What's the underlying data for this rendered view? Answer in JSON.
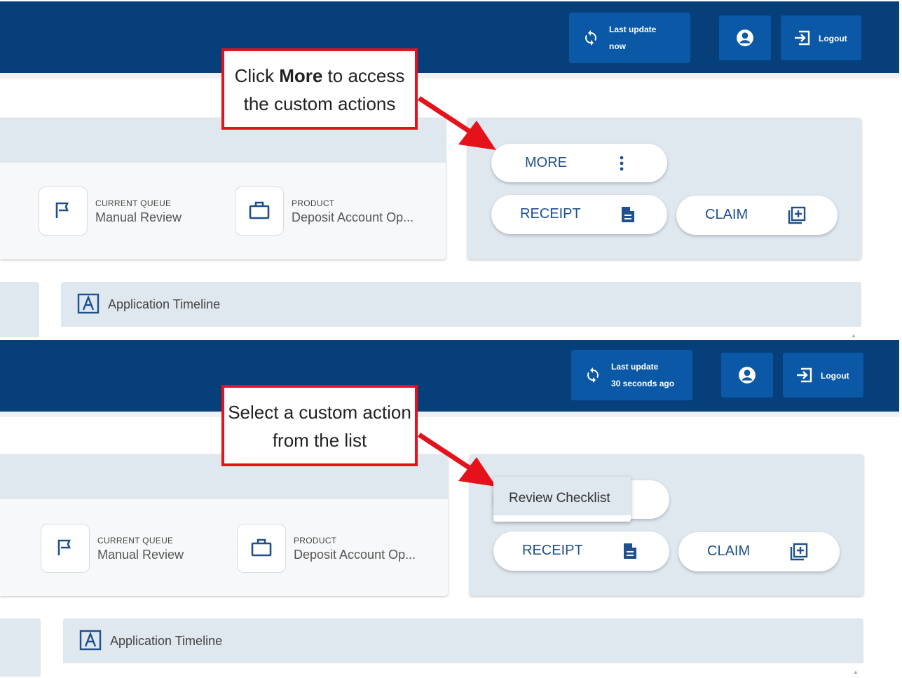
{
  "header": {
    "logout_label": "Logout",
    "last_update_label": "Last update",
    "colors": {
      "header_bg": "#063f7a",
      "header_button_bg": "#0a58a6",
      "card_bg": "#dfe7ef",
      "accent": "#1f4f8d",
      "callout_border": "#e5121b"
    }
  },
  "panels": [
    {
      "last_update_value": "now",
      "callout": {
        "pre": "Click ",
        "bold": "More",
        "post": " to access the custom actions"
      },
      "current_queue_label": "CURRENT QUEUE",
      "current_queue_value": "Manual Review",
      "product_label": "PRODUCT",
      "product_value": "Deposit Account Op...",
      "more_label": "MORE",
      "receipt_label": "RECEIPT",
      "claim_label": "CLAIM",
      "timeline_title": "Application Timeline"
    },
    {
      "last_update_value": "30 seconds ago",
      "callout": {
        "text": "Select a custom action from the list"
      },
      "current_queue_label": "CURRENT QUEUE",
      "current_queue_value": "Manual Review",
      "product_label": "PRODUCT",
      "product_value": "Deposit Account Op...",
      "menu_item": "Review Checklist",
      "receipt_label": "RECEIPT",
      "claim_label": "CLAIM",
      "timeline_title": "Application Timeline"
    }
  ]
}
